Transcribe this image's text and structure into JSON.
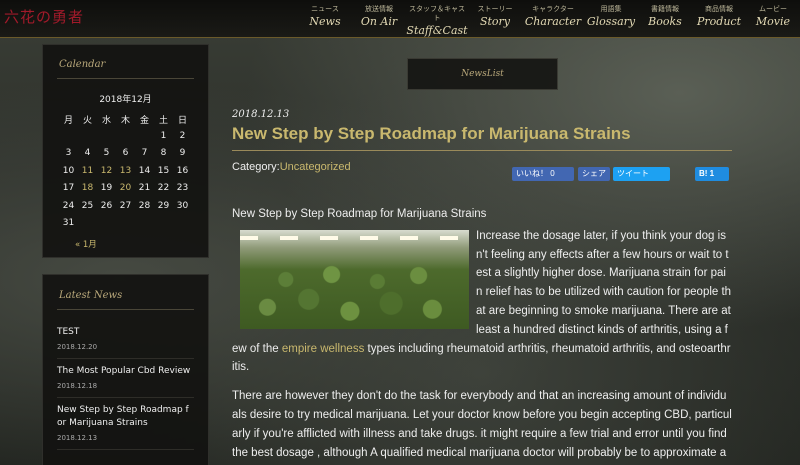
{
  "site": {
    "logo": "六花の勇者"
  },
  "nav": [
    {
      "jp": "ニュース",
      "en": "News"
    },
    {
      "jp": "放送情報",
      "en": "On Air"
    },
    {
      "jp": "スタッフ＆キャスト",
      "en": "Staff&Cast"
    },
    {
      "jp": "ストーリー",
      "en": "Story"
    },
    {
      "jp": "キャラクター",
      "en": "Character"
    },
    {
      "jp": "用語集",
      "en": "Glossary"
    },
    {
      "jp": "書籍情報",
      "en": "Books"
    },
    {
      "jp": "商品情報",
      "en": "Product"
    },
    {
      "jp": "ムービー",
      "en": "Movie"
    }
  ],
  "calendar": {
    "title": "Calendar",
    "caption": "2018年12月",
    "weekdays": [
      "月",
      "火",
      "水",
      "木",
      "金",
      "土",
      "日"
    ],
    "weeks": [
      [
        "",
        "",
        "",
        "",
        "",
        "1",
        "2"
      ],
      [
        "3",
        "4",
        "5",
        "6",
        "7",
        "8",
        "9"
      ],
      [
        "10",
        "11",
        "12",
        "13",
        "14",
        "15",
        "16"
      ],
      [
        "17",
        "18",
        "19",
        "20",
        "21",
        "22",
        "23"
      ],
      [
        "24",
        "25",
        "26",
        "27",
        "28",
        "29",
        "30"
      ],
      [
        "31",
        "",
        "",
        "",
        "",
        "",
        ""
      ]
    ],
    "linked_days": [
      "11",
      "12",
      "13",
      "18",
      "20"
    ],
    "prev_link": "« 1月"
  },
  "latest_news": {
    "title": "Latest News",
    "items": [
      {
        "title": "TEST",
        "date": "2018.12.20"
      },
      {
        "title": "The Most Popular Cbd Review",
        "date": "2018.12.18"
      },
      {
        "title": "New Step by Step Roadmap for Marijuana Strains",
        "date": "2018.12.13"
      }
    ]
  },
  "main": {
    "section_label": "NewsList",
    "post": {
      "date": "2018.12.13",
      "title": "New Step by Step Roadmap for Marijuana Strains",
      "category_label": "Category:",
      "category": "Uncategorized",
      "share": {
        "like": "いいね！ 0",
        "share": "シェア",
        "tweet": "ツイート",
        "hatena": "B! 1"
      },
      "heading": "New Step by Step Roadmap for Marijuana Strains",
      "para1": "Increase the dosage later, if you think your dog isn't feeling any effects after a few hours or wait to test a slightly higher dose. Marijuana strain for pain relief has to be utilized with caution for people that are beginning to smoke marijuana. There are at least a hundred distinct kinds of arthritis, using a few of the ",
      "para1_link": "empire wellness",
      "para1_end": " types including rheumatoid arthritis, rheumatoid arthritis, and osteoarthritis.",
      "para2": "There are however they don't do the task for everybody and that an increasing amount of individuals desire to try medical marijuana. Let your doctor know before you begin accepting CBD, particularly if you're afflicted with illness and take drugs. it might require a few trial and error until you find the best dosage , although A qualified medical marijuana doctor will probably be to approximate an acceptable dose for you."
    }
  },
  "colors": {
    "accent_gold": "#c9b86e",
    "logo_red": "#a11a2a",
    "facebook": "#4267b2",
    "twitter": "#1da1f2",
    "hatena": "#1f8ce0"
  }
}
